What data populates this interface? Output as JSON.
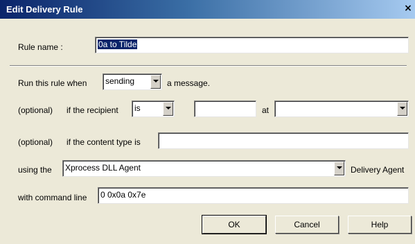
{
  "window": {
    "title": "Edit Delivery Rule",
    "close_glyph": "×"
  },
  "rule_name": {
    "label": "Rule name :",
    "value": "0a to Tilde"
  },
  "run_when": {
    "label": "Run this rule when",
    "value": "sending",
    "suffix": "a message."
  },
  "recipient": {
    "optional_label": "(optional)",
    "label": "if the recipient",
    "operator": "is",
    "value": "",
    "at_label": "at",
    "at_value": ""
  },
  "content_type": {
    "optional_label": "(optional)",
    "label": "if the content type is",
    "value": ""
  },
  "agent": {
    "label": "using the",
    "value": "Xprocess DLL Agent",
    "suffix": "Delivery Agent"
  },
  "command_line": {
    "label": "with command line",
    "value": "0 0x0a 0x7e"
  },
  "buttons": {
    "ok": "OK",
    "cancel": "Cancel",
    "help": "Help"
  }
}
